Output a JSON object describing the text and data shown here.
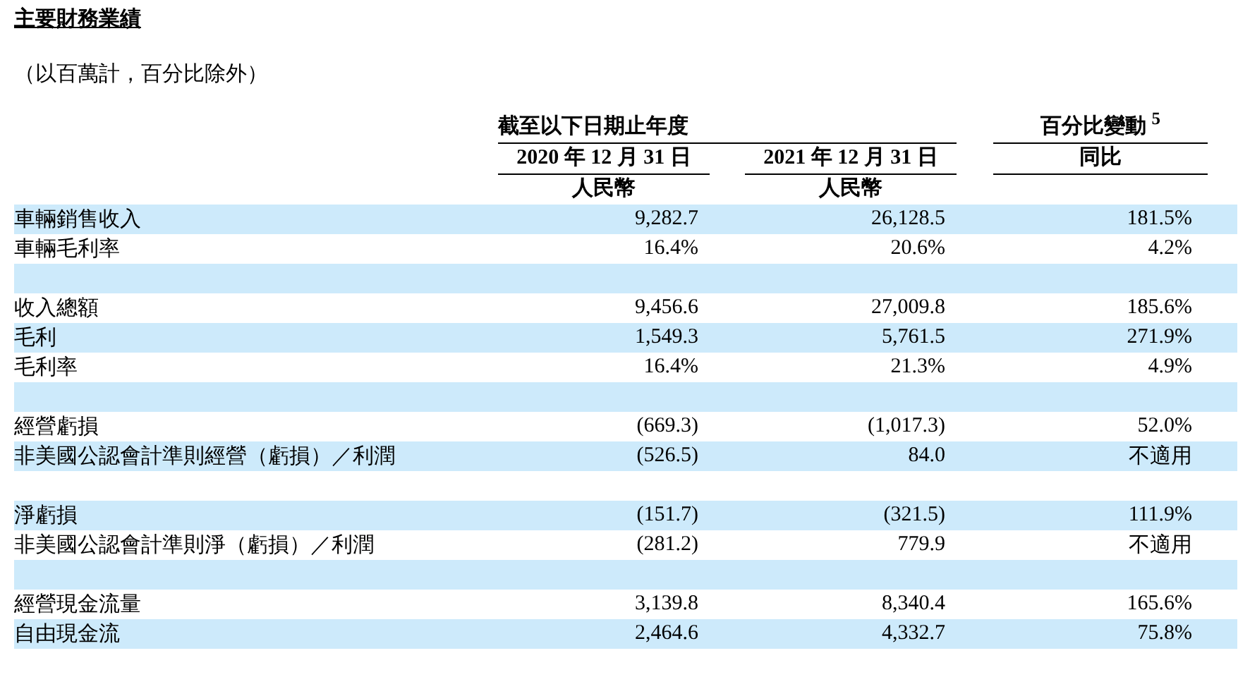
{
  "title": "主要財務業績",
  "note": "（以百萬計，百分比除外）",
  "table": {
    "group_header": "截至以下日期止年度",
    "change_header": "百分比變動 $^{5}$",
    "columns": [
      {
        "date": "2020 年 12 月 31 日",
        "currency": "人民幣"
      },
      {
        "date": "2021 年 12 月 31 日",
        "currency": "人民幣"
      }
    ],
    "change_subheader": "同比",
    "rows": [
      {
        "kind": "data",
        "label": "車輛銷售收入",
        "values": [
          "9,282.7",
          "26,128.5",
          "181.5%"
        ]
      },
      {
        "kind": "data",
        "label": "車輛毛利率",
        "values": [
          "16.4%",
          "20.6%",
          "4.2%"
        ]
      },
      {
        "kind": "spacer"
      },
      {
        "kind": "data",
        "label": "收入總額",
        "values": [
          "9,456.6",
          "27,009.8",
          "185.6%"
        ]
      },
      {
        "kind": "data",
        "label": "毛利",
        "values": [
          "1,549.3",
          "5,761.5",
          "271.9%"
        ]
      },
      {
        "kind": "data",
        "label": "毛利率",
        "values": [
          "16.4%",
          "21.3%",
          "4.9%"
        ]
      },
      {
        "kind": "spacer"
      },
      {
        "kind": "data",
        "label": "經營虧損",
        "values": [
          "(669.3)",
          "(1,017.3)",
          "52.0%"
        ]
      },
      {
        "kind": "data",
        "label": "非美國公認會計準則經營（虧損）／利潤",
        "values": [
          "(526.5)",
          "84.0",
          "不適用"
        ]
      },
      {
        "kind": "spacer"
      },
      {
        "kind": "data",
        "label": "淨虧損",
        "values": [
          "(151.7)",
          "(321.5)",
          "111.9%"
        ]
      },
      {
        "kind": "data",
        "label": "非美國公認會計準則淨（虧損）／利潤",
        "values": [
          "(281.2)",
          "779.9",
          "不適用"
        ]
      },
      {
        "kind": "spacer"
      },
      {
        "kind": "data",
        "label": "經營現金流量",
        "values": [
          "3,139.8",
          "8,340.4",
          "165.6%"
        ]
      },
      {
        "kind": "data",
        "label": "自由現金流",
        "values": [
          "2,464.6",
          "4,332.7",
          "75.8%"
        ]
      }
    ]
  }
}
